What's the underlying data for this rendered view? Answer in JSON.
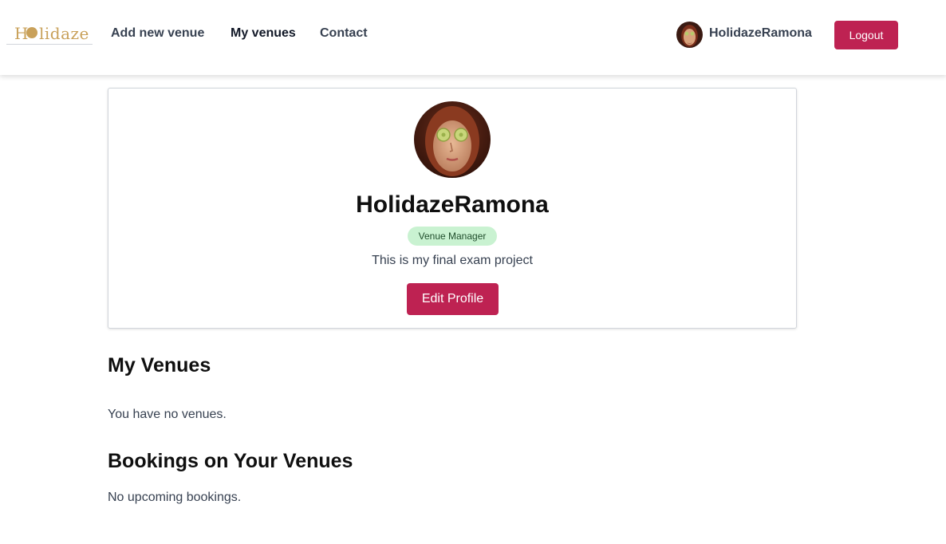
{
  "header": {
    "logo": {
      "first_letter": "H",
      "rest": "lidaze"
    },
    "nav": {
      "add_new_venue": "Add new venue",
      "my_venues": "My venues",
      "contact": "Contact"
    },
    "user": {
      "name": "HolidazeRamona"
    },
    "logout_label": "Logout"
  },
  "profile": {
    "name": "HolidazeRamona",
    "role_badge": "Venue Manager",
    "bio": "This is my final exam project",
    "edit_label": "Edit Profile"
  },
  "my_venues": {
    "title": "My Venues",
    "empty_text": "You have no venues."
  },
  "bookings": {
    "title": "Bookings on Your Venues",
    "empty_text": "No upcoming bookings."
  },
  "colors": {
    "accent": "#be2252",
    "logo": "#c9a15a",
    "badge_bg": "#c9f2d1",
    "badge_text": "#1f4d2b"
  }
}
